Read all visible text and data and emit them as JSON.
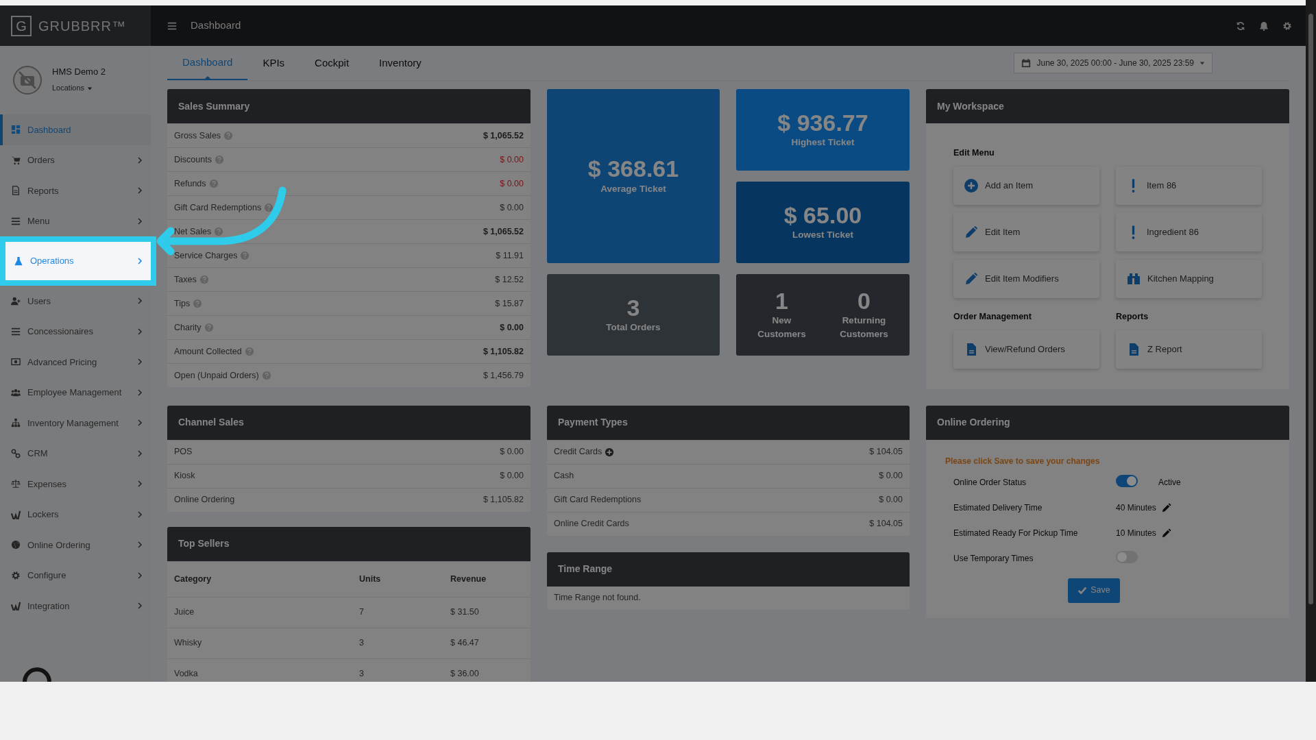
{
  "brand": {
    "logo_letter": "G",
    "name": "GRUBBRR™"
  },
  "account": {
    "name": "HMS Demo 2",
    "locations": "Locations"
  },
  "sidebar": {
    "items": [
      {
        "label": "Dashboard",
        "selected": true,
        "expandable": false,
        "highlighted": false
      },
      {
        "label": "Orders",
        "selected": false,
        "expandable": true,
        "highlighted": false
      },
      {
        "label": "Reports",
        "selected": false,
        "expandable": true,
        "highlighted": false
      },
      {
        "label": "Menu",
        "selected": false,
        "expandable": true,
        "highlighted": false
      },
      {
        "label": "Operations",
        "selected": false,
        "expandable": true,
        "highlighted": true
      },
      {
        "label": "Users",
        "selected": false,
        "expandable": true,
        "highlighted": false
      },
      {
        "label": "Concessionaires",
        "selected": false,
        "expandable": true,
        "highlighted": false
      },
      {
        "label": "Advanced Pricing",
        "selected": false,
        "expandable": true,
        "highlighted": false
      },
      {
        "label": "Employee Management",
        "selected": false,
        "expandable": true,
        "highlighted": false
      },
      {
        "label": "Inventory Management",
        "selected": false,
        "expandable": true,
        "highlighted": false
      },
      {
        "label": "CRM",
        "selected": false,
        "expandable": true,
        "highlighted": false
      },
      {
        "label": "Expenses",
        "selected": false,
        "expandable": true,
        "highlighted": false
      },
      {
        "label": "Lockers",
        "selected": false,
        "expandable": true,
        "highlighted": false
      },
      {
        "label": "Online Ordering",
        "selected": false,
        "expandable": true,
        "highlighted": false
      },
      {
        "label": "Configure",
        "selected": false,
        "expandable": true,
        "highlighted": false
      },
      {
        "label": "Integration",
        "selected": false,
        "expandable": true,
        "highlighted": false
      }
    ]
  },
  "header": {
    "title": "Dashboard"
  },
  "tabs": [
    {
      "label": "Dashboard",
      "selected": true
    },
    {
      "label": "KPIs",
      "selected": false
    },
    {
      "label": "Cockpit",
      "selected": false
    },
    {
      "label": "Inventory",
      "selected": false
    }
  ],
  "date_range": "June 30, 2025 00:00 - June 30, 2025 23:59",
  "sales_summary": {
    "title": "Sales Summary",
    "rows": [
      {
        "label": "Gross Sales",
        "value": "$ 1,065.52",
        "emphasis": true,
        "negative": false
      },
      {
        "label": "Discounts",
        "value": "$ 0.00",
        "emphasis": false,
        "negative": true
      },
      {
        "label": "Refunds",
        "value": "$ 0.00",
        "emphasis": false,
        "negative": true
      },
      {
        "label": "Gift Card Redemptions",
        "value": "$ 0.00",
        "emphasis": false,
        "negative": false
      },
      {
        "label": "Net Sales",
        "value": "$ 1,065.52",
        "emphasis": true,
        "negative": false
      },
      {
        "label": "Service Charges",
        "value": "$ 11.91",
        "emphasis": false,
        "negative": false
      },
      {
        "label": "Taxes",
        "value": "$ 12.52",
        "emphasis": false,
        "negative": false
      },
      {
        "label": "Tips",
        "value": "$ 15.87",
        "emphasis": false,
        "negative": false
      },
      {
        "label": "Charity",
        "value": "$ 0.00",
        "emphasis": true,
        "negative": false
      },
      {
        "label": "Amount Collected",
        "value": "$ 1,105.82",
        "emphasis": true,
        "negative": false
      },
      {
        "label": "Open (Unpaid Orders)",
        "value": "$ 1,456.79",
        "emphasis": false,
        "negative": false
      }
    ]
  },
  "tiles": [
    {
      "kind": "average",
      "value": "$ 368.61",
      "label": "Average Ticket"
    },
    {
      "kind": "highest",
      "value": "$ 936.77",
      "label": "Highest Ticket"
    },
    {
      "kind": "lowest",
      "value": "$ 65.00",
      "label": "Lowest Ticket"
    },
    {
      "kind": "orders",
      "value": "3",
      "label": "Total Orders"
    },
    {
      "kind": "customers",
      "stats": [
        {
          "value": "1",
          "label": "New Customers"
        },
        {
          "value": "0",
          "label": "Returning Customers"
        }
      ]
    }
  ],
  "workspace": {
    "title": "My Workspace",
    "rows": [
      {
        "sections": [
          {
            "title": "Edit Menu",
            "buttons": [
              "Add an Item",
              "Item 86",
              "Edit Item",
              "Ingredient 86",
              "Edit Item Modifiers",
              "Kitchen Mapping"
            ]
          }
        ]
      },
      {
        "sections": [
          {
            "title": "Order Management",
            "buttons": [
              "View/Refund Orders"
            ]
          },
          {
            "title": "Reports",
            "buttons": [
              "Z Report"
            ]
          }
        ]
      }
    ]
  },
  "channel_sales": {
    "title": "Channel Sales",
    "rows": [
      {
        "label": "POS",
        "value": "$ 0.00"
      },
      {
        "label": "Kiosk",
        "value": "$ 0.00"
      },
      {
        "label": "Online Ordering",
        "value": "$ 1,105.82"
      }
    ]
  },
  "top_sellers": {
    "title": "Top Sellers",
    "columns": [
      "Category",
      "Units",
      "Revenue"
    ],
    "rows": [
      [
        "Juice",
        "7",
        "$ 31.50"
      ],
      [
        "Whisky",
        "3",
        "$ 46.47"
      ],
      [
        "Vodka",
        "3",
        "$ 36.00"
      ]
    ]
  },
  "payment_types": {
    "title": "Payment Types",
    "rows": [
      {
        "label": "Credit Cards",
        "value": "$ 104.05",
        "expandable": true
      },
      {
        "label": "Cash",
        "value": "$ 0.00",
        "expandable": false
      },
      {
        "label": "Gift Card Redemptions",
        "value": "$ 0.00",
        "expandable": false
      },
      {
        "label": "Online Credit Cards",
        "value": "$ 104.05",
        "expandable": false
      }
    ]
  },
  "time_range": {
    "title": "Time Range",
    "message": "Time Range not found."
  },
  "online_ordering": {
    "title": "Online Ordering",
    "notice": "Please click Save to save your changes",
    "rows": [
      {
        "kind": "toggle",
        "label": "Online Order Status",
        "on": true,
        "status": "Active"
      },
      {
        "kind": "time",
        "label": "Estimated Delivery Time",
        "value": "40 Minutes"
      },
      {
        "kind": "time",
        "label": "Estimated Ready For Pickup Time",
        "value": "10 Minutes"
      },
      {
        "kind": "toggle",
        "label": "Use Temporary Times",
        "on": false
      }
    ],
    "save": "Save"
  }
}
